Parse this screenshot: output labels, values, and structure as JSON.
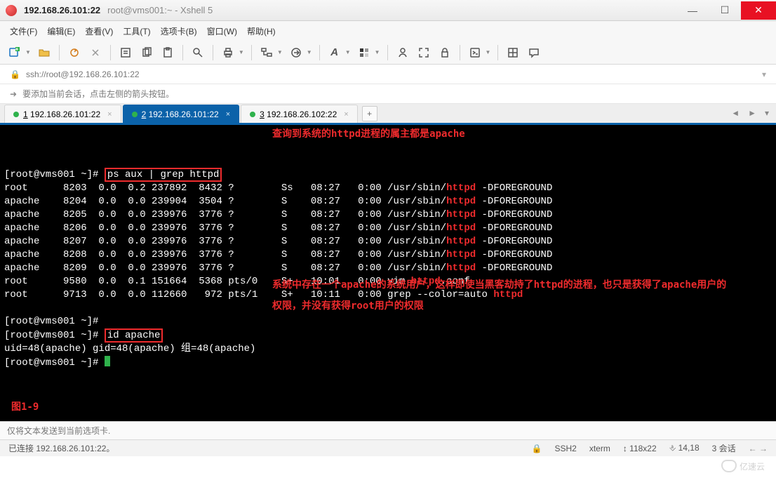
{
  "window": {
    "title_main": "192.168.26.101:22",
    "title_sub": "root@vms001:~ - Xshell 5"
  },
  "menu": {
    "file": "文件(F)",
    "edit": "编辑(E)",
    "view": "查看(V)",
    "tools": "工具(T)",
    "tabs": "选项卡(B)",
    "window": "窗口(W)",
    "help": "帮助(H)"
  },
  "address": {
    "scheme_icon": "🔒",
    "url": "ssh://root@192.168.26.101:22"
  },
  "hint": {
    "icon": "➜",
    "text": "要添加当前会话，点击左侧的箭头按钮。"
  },
  "tabs": [
    {
      "label": "1 192.168.26.101:22",
      "active": false
    },
    {
      "label": "2 192.168.26.101:22",
      "active": true
    },
    {
      "label": "3 192.168.26.102:22",
      "active": false
    }
  ],
  "tab_add": "+",
  "terminal": {
    "prompt1": "[root@vms001 ~]# ",
    "cmd1": "ps aux | grep httpd",
    "anno1": "查询到系统的httpd进程的属主都是apache",
    "rows": [
      {
        "u": "root  ",
        "p": "8203",
        "c": "0.0",
        "m": "0.2",
        "vsz": "237892",
        "rss": "8432",
        "tty": "?    ",
        "st": "Ss",
        "tm": "08:27",
        "cp": "0:00",
        "pre": "/usr/sbin/",
        "hl": "httpd",
        "post": " -DFOREGROUND"
      },
      {
        "u": "apache",
        "p": "8204",
        "c": "0.0",
        "m": "0.0",
        "vsz": "239904",
        "rss": "3504",
        "tty": "?    ",
        "st": "S ",
        "tm": "08:27",
        "cp": "0:00",
        "pre": "/usr/sbin/",
        "hl": "httpd",
        "post": " -DFOREGROUND"
      },
      {
        "u": "apache",
        "p": "8205",
        "c": "0.0",
        "m": "0.0",
        "vsz": "239976",
        "rss": "3776",
        "tty": "?    ",
        "st": "S ",
        "tm": "08:27",
        "cp": "0:00",
        "pre": "/usr/sbin/",
        "hl": "httpd",
        "post": " -DFOREGROUND"
      },
      {
        "u": "apache",
        "p": "8206",
        "c": "0.0",
        "m": "0.0",
        "vsz": "239976",
        "rss": "3776",
        "tty": "?    ",
        "st": "S ",
        "tm": "08:27",
        "cp": "0:00",
        "pre": "/usr/sbin/",
        "hl": "httpd",
        "post": " -DFOREGROUND"
      },
      {
        "u": "apache",
        "p": "8207",
        "c": "0.0",
        "m": "0.0",
        "vsz": "239976",
        "rss": "3776",
        "tty": "?    ",
        "st": "S ",
        "tm": "08:27",
        "cp": "0:00",
        "pre": "/usr/sbin/",
        "hl": "httpd",
        "post": " -DFOREGROUND"
      },
      {
        "u": "apache",
        "p": "8208",
        "c": "0.0",
        "m": "0.0",
        "vsz": "239976",
        "rss": "3776",
        "tty": "?    ",
        "st": "S ",
        "tm": "08:27",
        "cp": "0:00",
        "pre": "/usr/sbin/",
        "hl": "httpd",
        "post": " -DFOREGROUND"
      },
      {
        "u": "apache",
        "p": "8209",
        "c": "0.0",
        "m": "0.0",
        "vsz": "239976",
        "rss": "3776",
        "tty": "?    ",
        "st": "S ",
        "tm": "08:27",
        "cp": "0:00",
        "pre": "/usr/sbin/",
        "hl": "httpd",
        "post": " -DFOREGROUND"
      },
      {
        "u": "root  ",
        "p": "9580",
        "c": "0.0",
        "m": "0.1",
        "vsz": "151664",
        "rss": "5368",
        "tty": "pts/0",
        "st": "S+",
        "tm": "10:01",
        "cp": "0:00",
        "pre": "vim ",
        "hl": "httpd",
        "post": ".conf"
      },
      {
        "u": "root  ",
        "p": "9713",
        "c": "0.0",
        "m": "0.0",
        "vsz": "112660",
        "rss": " 972",
        "tty": "pts/1",
        "st": "S+",
        "tm": "10:11",
        "cp": "0:00",
        "pre": "grep --color=auto ",
        "hl": "httpd",
        "post": ""
      }
    ],
    "prompt2": "[root@vms001 ~]# ",
    "prompt3": "[root@vms001 ~]# ",
    "cmd2": "id apache",
    "anno2": "系统中存在一个apache的系统用户，这样即使当黑客劫持了httpd的进程，也只是获得了apache用户的权限，并没有获得root用户的权限",
    "id_output": "uid=48(apache) gid=48(apache) 组=48(apache)",
    "prompt4": "[root@vms001 ~]# ",
    "figure": "图1-9"
  },
  "inputbar_placeholder": "仅将文本发送到当前选项卡.",
  "status": {
    "conn": "已连接  192.168.26.101:22。",
    "proto_icon": "🔒",
    "proto": "SSH2",
    "term": "xterm",
    "size_icon": "↕",
    "size": "118x22",
    "caret_icon": "⎀",
    "caret": "14,18",
    "sessions": "3 会话",
    "sessions_icon": "←  →"
  },
  "watermark": "亿速云"
}
